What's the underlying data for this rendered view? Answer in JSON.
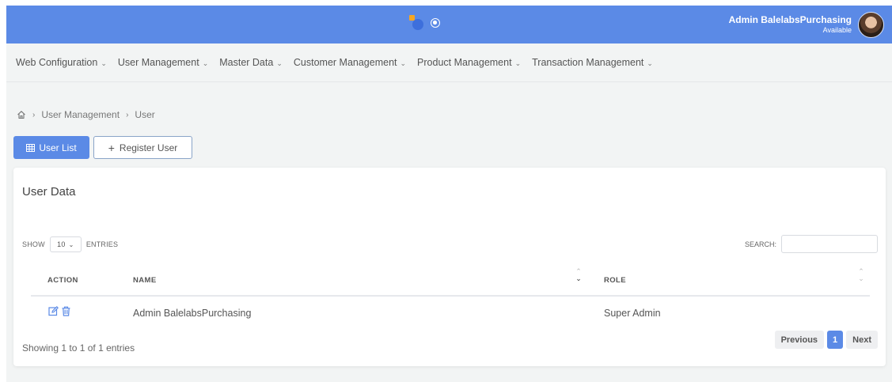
{
  "header": {
    "user_name": "Admin BalelabsPurchasing",
    "user_status": "Available"
  },
  "menu": [
    {
      "label": "Web Configuration"
    },
    {
      "label": "User Management"
    },
    {
      "label": "Master Data"
    },
    {
      "label": "Customer Management"
    },
    {
      "label": "Product Management"
    },
    {
      "label": "Transaction Management"
    }
  ],
  "breadcrumb": [
    "User Management",
    "User"
  ],
  "buttons": {
    "user_list": "User List",
    "register_user": "Register User"
  },
  "card": {
    "title": "User Data",
    "show_label": "SHOW",
    "length_value": "10",
    "entries_label": "ENTRIES",
    "search_label": "SEARCH:"
  },
  "table": {
    "columns": [
      "ACTION",
      "NAME",
      "ROLE"
    ],
    "rows": [
      {
        "name": "Admin BalelabsPurchasing",
        "role": "Super Admin"
      }
    ]
  },
  "footer": {
    "info": "Showing 1 to 1 of 1 entries",
    "prev": "Previous",
    "page": "1",
    "next": "Next"
  },
  "colors": {
    "primary": "#5b8ae6",
    "logo_orange": "#f5a623"
  }
}
